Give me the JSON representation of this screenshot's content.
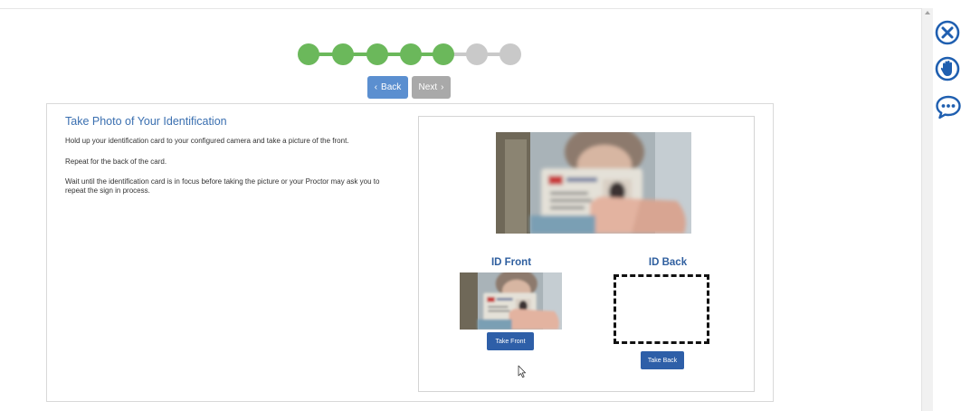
{
  "progress": {
    "completed_steps": 5,
    "total_steps": 7
  },
  "nav": {
    "back_label": "Back",
    "next_label": "Next",
    "back_chevron": "‹",
    "next_chevron": "›"
  },
  "instructions": {
    "title": "Take Photo of Your Identification",
    "paragraphs": [
      "Hold up your identification card to your configured camera and take a picture of the front.",
      "Repeat for the back of the card.",
      "Wait until the identification card is in focus before taking the picture or your Proctor may ask you to repeat the sign in process."
    ]
  },
  "capture": {
    "front_label": "ID Front",
    "back_label": "ID Back",
    "take_front_label": "Take Front",
    "take_back_label": "Take Back"
  },
  "side_icons": [
    "close-circle-icon",
    "raise-hand-icon",
    "chat-bubble-icon"
  ],
  "colors": {
    "accent": "#2f5f9f",
    "done": "#6bb85b",
    "todo": "#c9c9c9",
    "side_icon": "#1f5fb0"
  }
}
